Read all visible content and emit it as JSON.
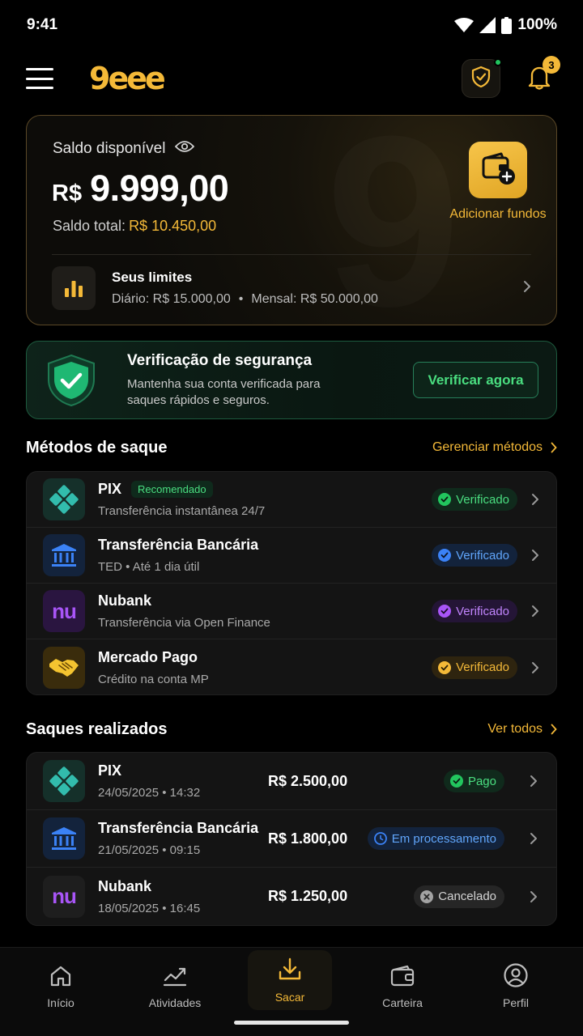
{
  "status_bar": {
    "time": "9:41",
    "battery": "100%"
  },
  "header": {
    "logo": "9eee",
    "notification_count": "3"
  },
  "balance": {
    "label": "Saldo disponível",
    "currency": "R$",
    "amount": "9.999,00",
    "total_label": "Saldo total:",
    "total_value": "R$ 10.450,00",
    "add_funds_label": "Adicionar fundos",
    "limits_title": "Seus limites",
    "daily": "Diário: R$ 15.000,00",
    "monthly": "Mensal: R$ 50.000,00"
  },
  "security": {
    "title": "Verificação de segurança",
    "description": "Mantenha sua conta verificada para saques rápidos e seguros.",
    "button_label": "Verificar agora"
  },
  "methods": {
    "title": "Métodos de saque",
    "link": "Gerenciar métodos",
    "items": [
      {
        "name": "PIX",
        "badge": "Recomendado",
        "subtitle": "Transferência instantânea 24/7",
        "status": "Verificado",
        "icon": "pix-icon",
        "color": "#22c55e"
      },
      {
        "name": "Transferência Bancária",
        "badge": "",
        "subtitle": "TED • Até 1 dia útil",
        "status": "Verificado",
        "icon": "bank-icon",
        "color": "#3b82f6"
      },
      {
        "name": "Nubank",
        "badge": "",
        "subtitle": "Transferência via Open Finance",
        "status": "Verificado",
        "icon": "nubank-icon",
        "color": "#a855f7"
      },
      {
        "name": "Mercado Pago",
        "badge": "",
        "subtitle": "Crédito na conta MP",
        "status": "Verificado",
        "icon": "handshake-icon",
        "color": "#f4b938"
      }
    ]
  },
  "withdrawals": {
    "title": "Saques realizados",
    "link": "Ver todos",
    "items": [
      {
        "name": "PIX",
        "date": "24/05/2025 • 14:32",
        "amount": "R$ 2.500,00",
        "status": "Pago",
        "icon": "pix-icon"
      },
      {
        "name": "Transferência Bancária",
        "date": "21/05/2025 • 09:15",
        "amount": "R$ 1.800,00",
        "status": "Em processamento",
        "icon": "bank-icon"
      },
      {
        "name": "Nubank",
        "date": "18/05/2025 • 16:45",
        "amount": "R$ 1.250,00",
        "status": "Cancelado",
        "icon": "nubank-icon"
      }
    ]
  },
  "nav": {
    "items": [
      {
        "label": "Início",
        "icon": "home-icon"
      },
      {
        "label": "Atividades",
        "icon": "activity-chart-icon"
      },
      {
        "label": "Sacar",
        "icon": "withdraw-icon",
        "active": true
      },
      {
        "label": "Carteira",
        "icon": "wallet-icon"
      },
      {
        "label": "Perfil",
        "icon": "profile-icon"
      }
    ]
  },
  "colors": {
    "accent": "#f4b938",
    "success": "#22c55e",
    "info": "#3b82f6",
    "purple": "#a855f7",
    "background": "#000000"
  }
}
